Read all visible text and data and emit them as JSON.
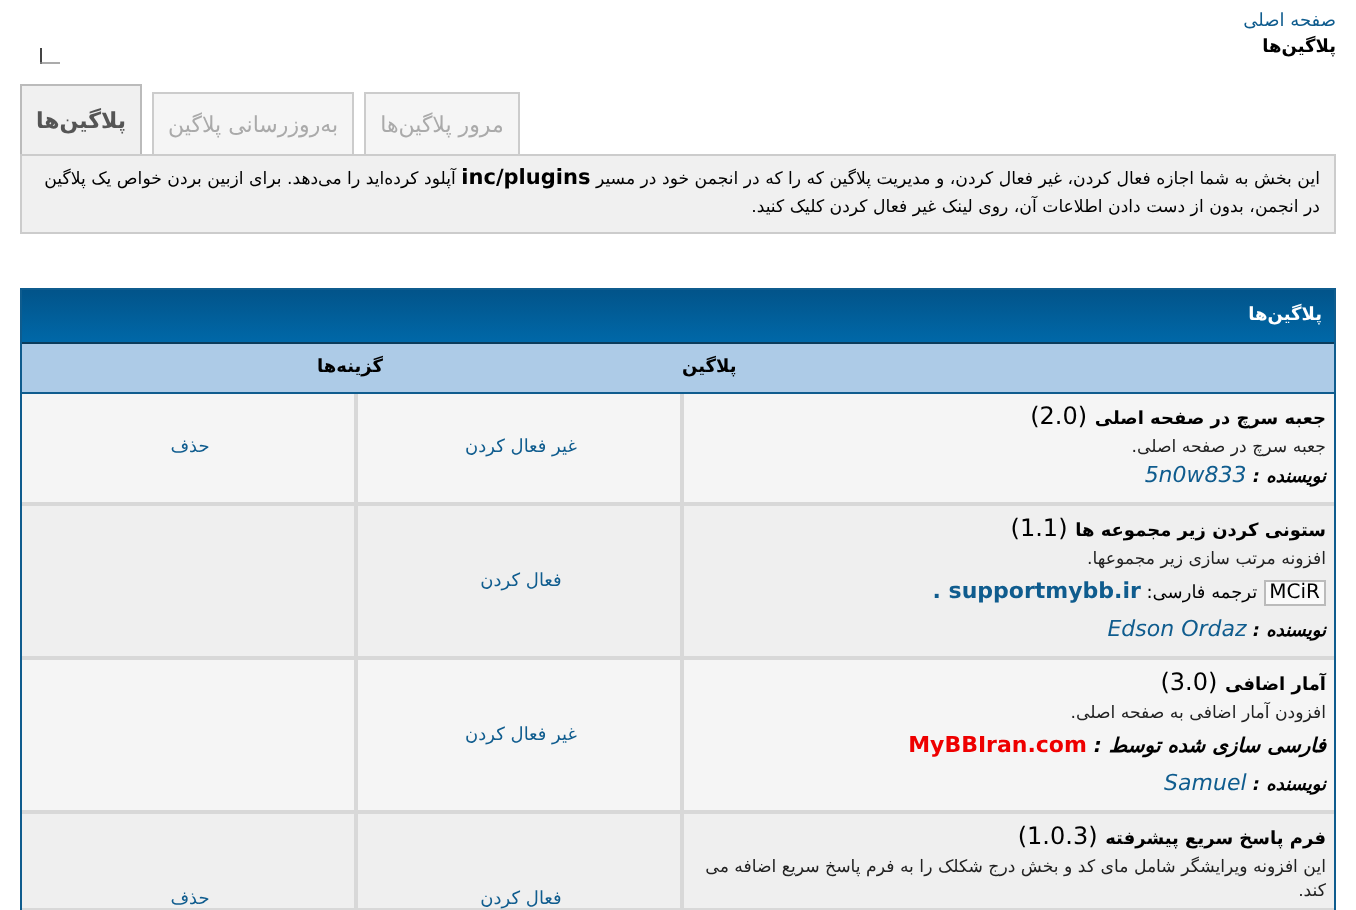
{
  "breadcrumb": {
    "home": "صفحه اصلی",
    "current": "پلاگین‌ها"
  },
  "tabs": [
    {
      "label": "مرور پلاگین‌ها",
      "selected": false
    },
    {
      "label": "به‌روزرسانی پلاگین",
      "selected": false
    },
    {
      "label": "پلاگین‌ها",
      "selected": true
    }
  ],
  "notice": "این بخش به شما اجازه فعال کردن، غیر فعال کردن، و مدیریت پلاگین که را که در انجمن خود در مسیر **inc/plugins** آپلود کرده‌اید را می‌دهد. برای ازبین بردن خواص یک پلاگین در انجمن، بدون از دست دادن اطلاعات آن، روی لینک غیر فعال کردن کلیک کنید.",
  "table": {
    "title": "پلاگین‌ها",
    "columns": [
      "پلاگین",
      "گزینه‌ها"
    ],
    "rows": [
      {
        "title": "**جعبه سرچ در صفحه اصلی** (2.0)",
        "description": "جعبه سرچ در صفحه اصلی.",
        "author_label": "نویسنده :",
        "author": "5n0w833",
        "toggle": "غیر فعال کردن",
        "delete": "حذف"
      },
      {
        "title": "**ستونی کردن زیر مجموعه ها** (1.1)",
        "description": "افزونه مرتب سازی زیر مجموعها.",
        "credit": {
          "kind": "translation",
          "badge": "MCiR",
          "label": "ترجمه فارسی:",
          "link": "supportmybb.ir",
          "suffix": "."
        },
        "author_label": "نویسنده :",
        "author": "Edson Ordaz",
        "toggle": "فعال کردن"
      },
      {
        "title": "**آمار اضافی** (3.0)",
        "description": "افزودن آمار اضافی به صفحه اصلی.",
        "credit": {
          "kind": "localization",
          "label": "فارسی سازی شده توسط :",
          "link": "MyBBIran.com"
        },
        "author_label": "نویسنده :",
        "author": "Samuel",
        "toggle": "غیر فعال کردن"
      },
      {
        "title": "**فرم پاسخ سریع پیشرفته** (1.0.3)",
        "description": "این افزونه ویرایشگر شامل مای کد و بخش درج شکلک را به فرم پاسخ سریع اضافه می کند.",
        "toggle": "فعال کردن",
        "delete": "حذف"
      }
    ]
  }
}
